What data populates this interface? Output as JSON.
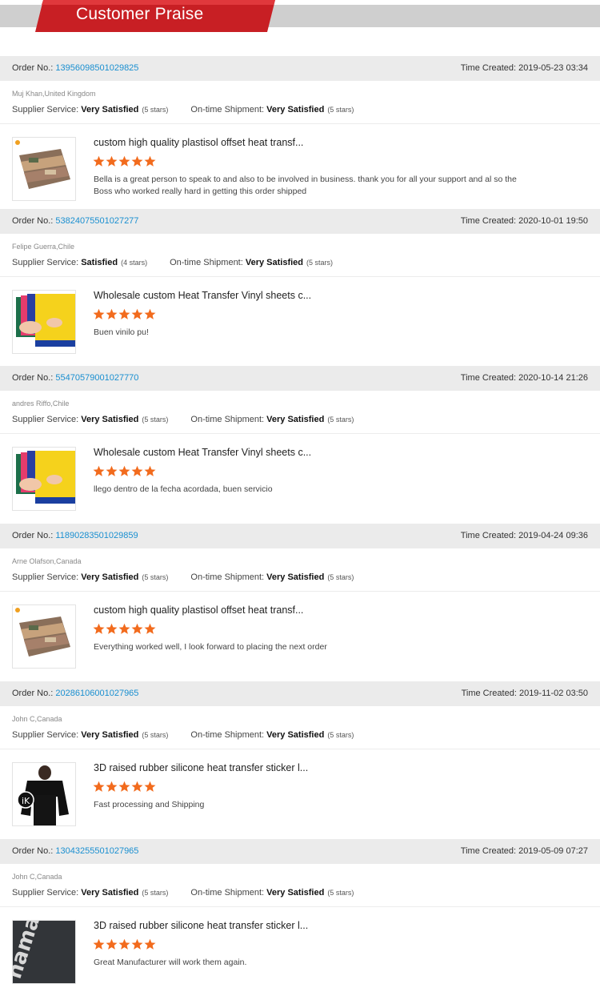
{
  "header": {
    "title": "Customer Praise"
  },
  "labels": {
    "order_no": "Order No.:",
    "time_created": "Time Created:",
    "supplier_service": "Supplier Service:",
    "ontime_shipment": "On-time Shipment:"
  },
  "colors": {
    "accent_red": "#d42428",
    "link_blue": "#1a8fd0",
    "star_orange": "#f26b1d"
  },
  "orders": [
    {
      "order_no": "13956098501029825",
      "time_created": "2019-05-23 03:34",
      "buyer": "Muj Khan,United Kingdom",
      "supplier_service": "Very Satisfied",
      "supplier_stars": "(5 stars)",
      "shipment": "Very Satisfied",
      "shipment_stars": "(5 stars)",
      "product_title": "custom high quality plastisol offset heat transf...",
      "rating": 5,
      "review": "Bella is a great person to speak to and also to be involved in business. thank you for all your support and al so the Boss who worked really hard in getting this order shipped",
      "thumb_icon": "plastisol-transfer-icon"
    },
    {
      "order_no": "53824075501027277",
      "time_created": "2020-10-01 19:50",
      "buyer": "Felipe Guerra,Chile",
      "supplier_service": "Satisfied",
      "supplier_stars": "(4 stars)",
      "shipment": "Very Satisfied",
      "shipment_stars": "(5 stars)",
      "product_title": "Wholesale custom Heat Transfer Vinyl sheets c...",
      "rating": 5,
      "review": "Buen vinilo pu!",
      "thumb_icon": "vinyl-sheets-icon"
    },
    {
      "order_no": "55470579001027770",
      "time_created": "2020-10-14 21:26",
      "buyer": "andres Riffo,Chile",
      "supplier_service": "Very Satisfied",
      "supplier_stars": "(5 stars)",
      "shipment": "Very Satisfied",
      "shipment_stars": "(5 stars)",
      "product_title": "Wholesale custom Heat Transfer Vinyl sheets c...",
      "rating": 5,
      "review": "llego dentro de la fecha acordada, buen servicio",
      "thumb_icon": "vinyl-sheets-icon"
    },
    {
      "order_no": "11890283501029859",
      "time_created": "2019-04-24 09:36",
      "buyer": "Arne Olafson,Canada",
      "supplier_service": "Very Satisfied",
      "supplier_stars": "(5 stars)",
      "shipment": "Very Satisfied",
      "shipment_stars": "(5 stars)",
      "product_title": "custom high quality plastisol offset heat transf...",
      "rating": 5,
      "review": "Everything worked well, I look forward to placing the next order",
      "thumb_icon": "plastisol-transfer-icon"
    },
    {
      "order_no": "20286106001027965",
      "time_created": "2019-11-02 03:50",
      "buyer": "John C,Canada",
      "supplier_service": "Very Satisfied",
      "supplier_stars": "(5 stars)",
      "shipment": "Very Satisfied",
      "shipment_stars": "(5 stars)",
      "product_title": "3D raised rubber silicone heat transfer sticker l...",
      "rating": 5,
      "review": "Fast processing and Shipping",
      "thumb_icon": "jacket-icon"
    },
    {
      "order_no": "13043255501027965",
      "time_created": "2019-05-09 07:27",
      "buyer": "John C,Canada",
      "supplier_service": "Very Satisfied",
      "supplier_stars": "(5 stars)",
      "shipment": "Very Satisfied",
      "shipment_stars": "(5 stars)",
      "product_title": "3D raised rubber silicone heat transfer sticker l...",
      "rating": 5,
      "review": "Great Manufacturer will work them again.",
      "thumb_icon": "silicone-label-icon",
      "thumb_text": "hama"
    }
  ]
}
